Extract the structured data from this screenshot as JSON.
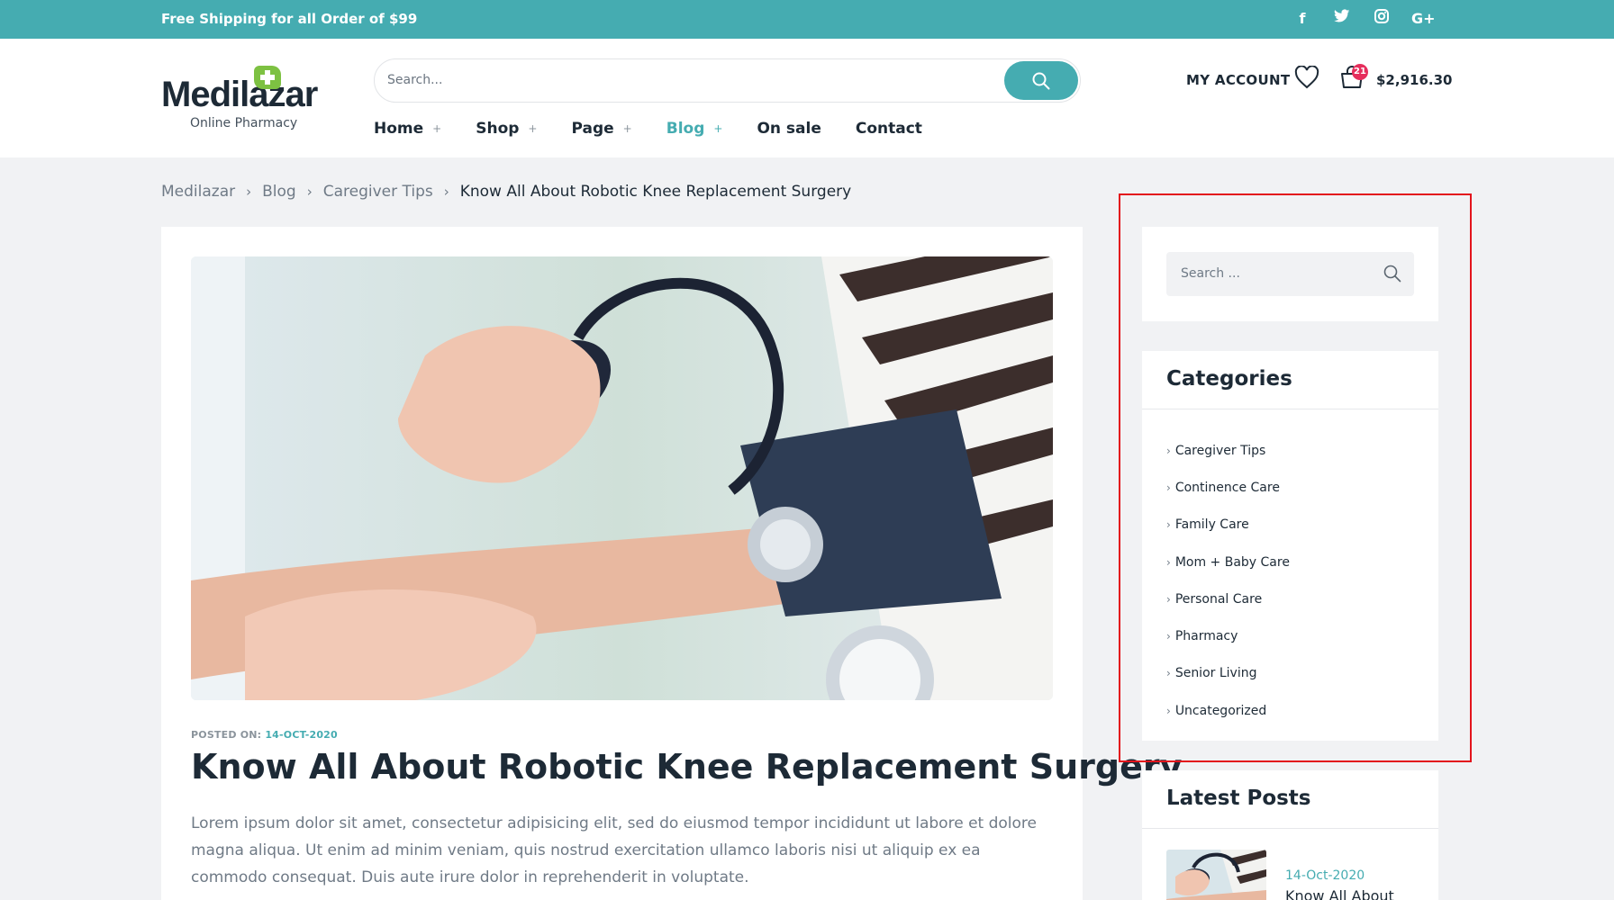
{
  "topbar": {
    "shipping_text": "Free Shipping for all Order of $99",
    "social": [
      "facebook-icon",
      "twitter-icon",
      "instagram-icon",
      "google-plus-icon"
    ]
  },
  "header": {
    "logo_name": "Medilazar",
    "logo_sub": "Online Pharmacy",
    "search_placeholder": "Search...",
    "account_label": "MY ACCOUNT",
    "cart_count": "21",
    "cart_total": "$2,916.30"
  },
  "nav": {
    "items": [
      {
        "label": "Home",
        "has_sub": true
      },
      {
        "label": "Shop",
        "has_sub": true
      },
      {
        "label": "Page",
        "has_sub": true
      },
      {
        "label": "Blog",
        "has_sub": true,
        "active": true
      },
      {
        "label": "On sale",
        "has_sub": false
      },
      {
        "label": "Contact",
        "has_sub": false
      }
    ]
  },
  "breadcrumb": {
    "items": [
      "Medilazar",
      "Blog",
      "Caregiver Tips"
    ],
    "current": "Know All About Robotic Knee Replacement Surgery"
  },
  "post": {
    "posted_on_label": "POSTED ON:",
    "date": "14-OCT-2020",
    "title": "Know All About Robotic Knee Replacement Surgery",
    "excerpt": "Lorem ipsum dolor sit amet, consectetur adipisicing elit, sed do eiusmod tempor incididunt ut labore et dolore magna aliqua. Ut enim ad minim veniam, quis nostrud exercitation ullamco laboris nisi ut aliquip ex ea commodo consequat. Duis aute irure dolor in reprehenderit in voluptate."
  },
  "sidebar": {
    "search_placeholder": "Search ...",
    "categories_title": "Categories",
    "categories": [
      "Caregiver Tips",
      "Continence Care",
      "Family Care",
      "Mom + Baby Care",
      "Personal Care",
      "Pharmacy",
      "Senior Living",
      "Uncategorized"
    ],
    "latest_title": "Latest Posts",
    "latest": [
      {
        "date": "14-Oct-2020",
        "title": "Know All About"
      }
    ]
  },
  "colors": {
    "accent": "#45acb1",
    "badge": "#e62e5c",
    "highlight": "#e3141c"
  }
}
